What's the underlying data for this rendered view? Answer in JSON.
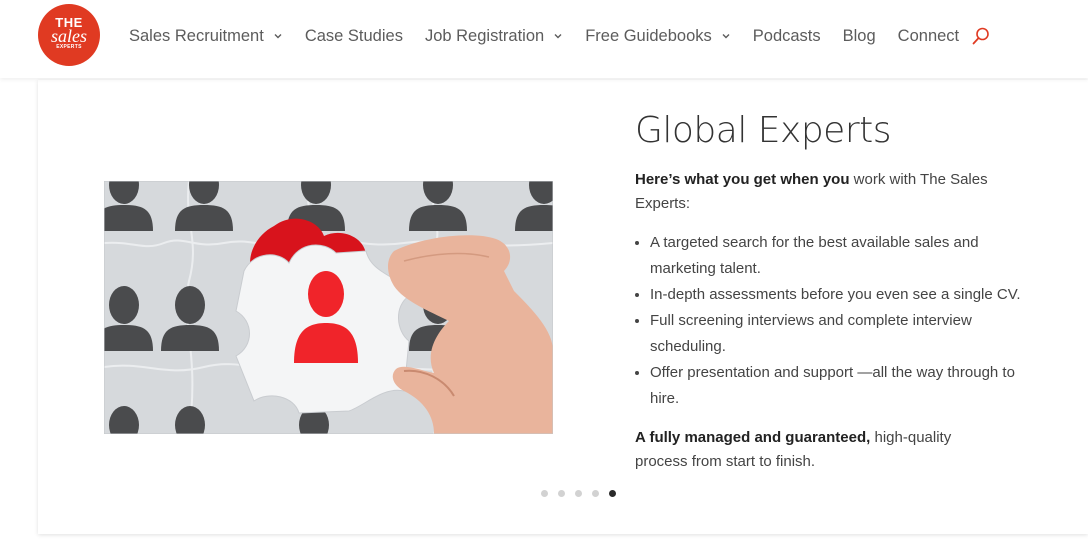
{
  "colors": {
    "brand": "#e03a22",
    "text": "#333333",
    "nav_text": "#5c5c5c"
  },
  "logo": {
    "line1": "THE",
    "line2": "sales",
    "line3": "EXPERTS"
  },
  "nav": {
    "items": [
      {
        "label": "Sales Recruitment",
        "has_dropdown": true
      },
      {
        "label": "Case Studies",
        "has_dropdown": false
      },
      {
        "label": "Job Registration",
        "has_dropdown": true
      },
      {
        "label": "Free Guidebooks",
        "has_dropdown": true
      },
      {
        "label": "Podcasts",
        "has_dropdown": false
      },
      {
        "label": "Blog",
        "has_dropdown": false
      },
      {
        "label": "Connect",
        "has_dropdown": false
      }
    ],
    "search_icon": "search-icon"
  },
  "slide": {
    "title": "Global Experts",
    "intro_bold": "Here’s what you get when you",
    "intro_rest": " work with The Sales Experts:",
    "bullets": [
      "A targeted search for the best available sales and marketing talent.",
      "In-depth assessments before you even see a single CV.",
      "Full screening interviews and complete interview scheduling.",
      "Offer presentation and support —all the way through to hire."
    ],
    "closing_bold": "A fully managed and guaranteed,",
    "closing_rest": " high-quality process from start to finish."
  },
  "carousel": {
    "dot_count": 5,
    "active_index": 4
  }
}
